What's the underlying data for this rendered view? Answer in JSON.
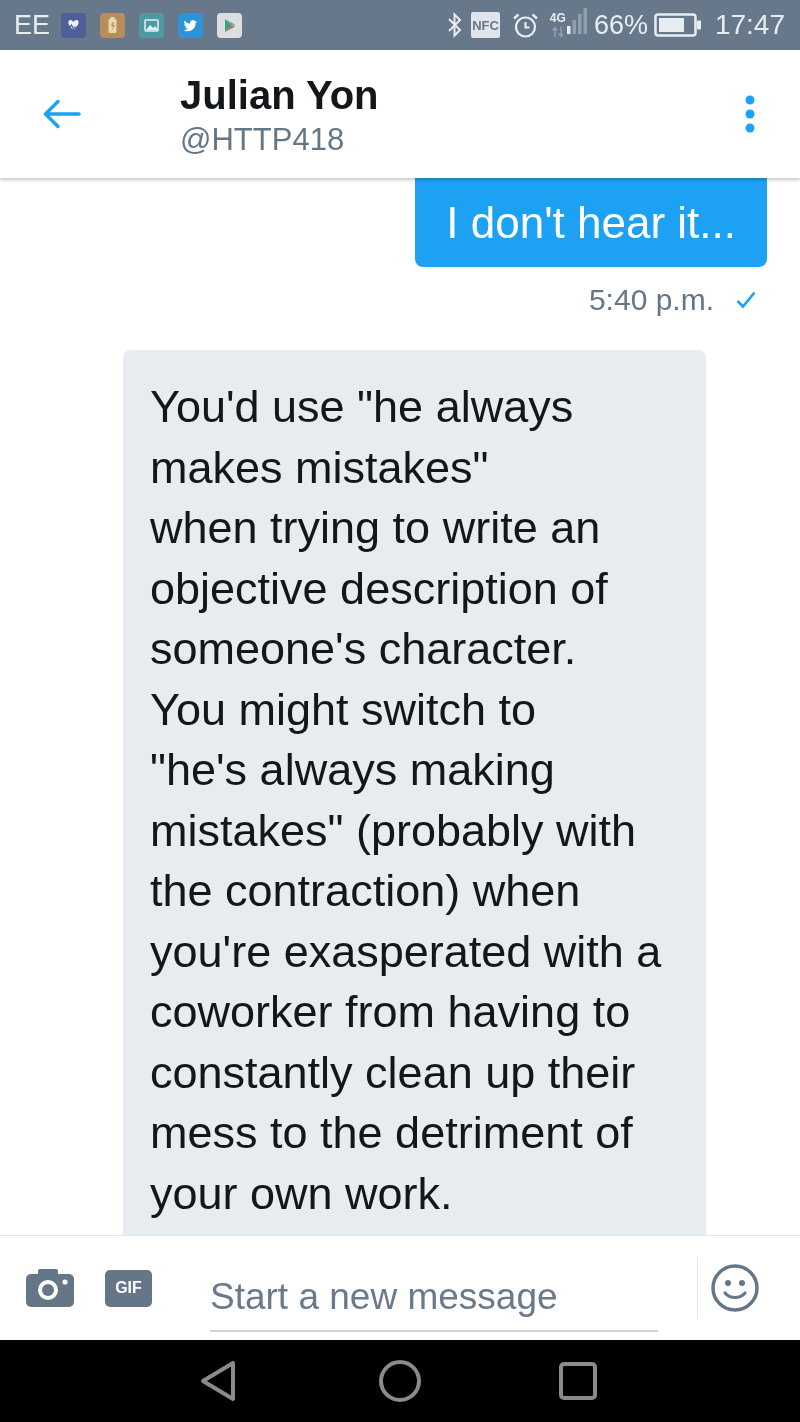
{
  "status_bar": {
    "carrier": "EE",
    "nfc_label": "NFC",
    "network_type": "4G",
    "battery": "66%",
    "time": "17:47"
  },
  "header": {
    "name": "Julian Yon",
    "handle": "@HTTP418"
  },
  "messages": [
    {
      "kind": "sent",
      "text": "I don't hear it...",
      "time": "5:40 p.m.",
      "delivered": true
    },
    {
      "kind": "received",
      "text": "You'd use \"he always makes mistakes\"\nwhen trying to write an objective description of someone's character.\nYou might switch to\n\"he's always making mistakes\" (probably with the contraction) when you're exasperated with a coworker from having to constantly clean up their mess to the detriment of your own work."
    }
  ],
  "composer": {
    "gif_label": "GIF",
    "placeholder": "Start a new message"
  }
}
